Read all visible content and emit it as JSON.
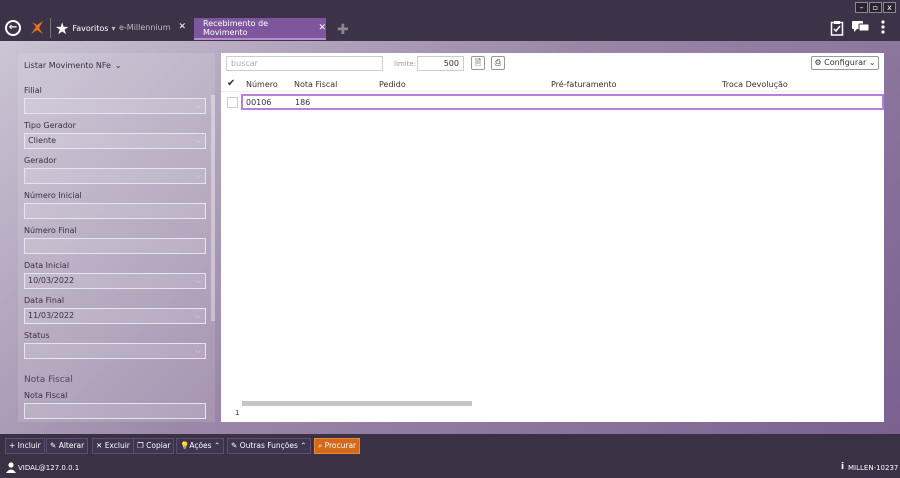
{
  "titlebar": {
    "window_controls": [
      "–",
      "▫",
      "x"
    ],
    "favorites_label": "Favoritos",
    "favorites_caret": "▾",
    "tab_emillennium": "e-Millennium",
    "tab_active": "Recebimento de Movimento",
    "close_glyph": "✕",
    "plus_glyph": "✚"
  },
  "left_panel": {
    "header": "Listar Movimento NFe",
    "fields": {
      "filial_label": "Filial",
      "filial_value": "",
      "tipo_gerador_label": "Tipo Gerador",
      "tipo_gerador_value": "Cliente",
      "gerador_label": "Gerador",
      "gerador_value": "",
      "numero_inicial_label": "Número Inicial",
      "numero_inicial_value": "",
      "numero_final_label": "Número Final",
      "numero_final_value": "",
      "data_inicial_label": "Data Inicial",
      "data_inicial_value": "10/03/2022",
      "data_final_label": "Data Final",
      "data_final_value": "11/03/2022",
      "status_label": "Status",
      "status_value": ""
    },
    "section_nota_fiscal": "Nota Fiscal",
    "nota_fiscal_label": "Nota Fiscal",
    "nota_fiscal_value": ""
  },
  "grid": {
    "search_placeholder": "buscar",
    "limit_label": "limite:",
    "limit_value": "500",
    "configure_label": "Configurar",
    "columns": [
      "Número",
      "Nota Fiscal",
      "Pedido",
      "Pré-faturamento",
      "Troca Devolução"
    ],
    "rows": [
      {
        "numero": "00106",
        "nota_fiscal": "186",
        "pedido": "",
        "pre_faturamento": "",
        "troca_devolucao": ""
      }
    ],
    "page": "1"
  },
  "actions": {
    "incluir": "Incluir",
    "alterar": "Alterar",
    "excluir": "Excluir",
    "copiar": "Copiar",
    "acoes": "Ações",
    "outras_funcoes": "Outras Funções",
    "procurar": "Procurar"
  },
  "status_bar": {
    "user": "VIDAL@127.0.0.1",
    "version": "MILLEN-10237"
  },
  "colors": {
    "accent": "#7e569d",
    "action_orange": "#d4691c",
    "bar_bg": "#3a3145"
  }
}
